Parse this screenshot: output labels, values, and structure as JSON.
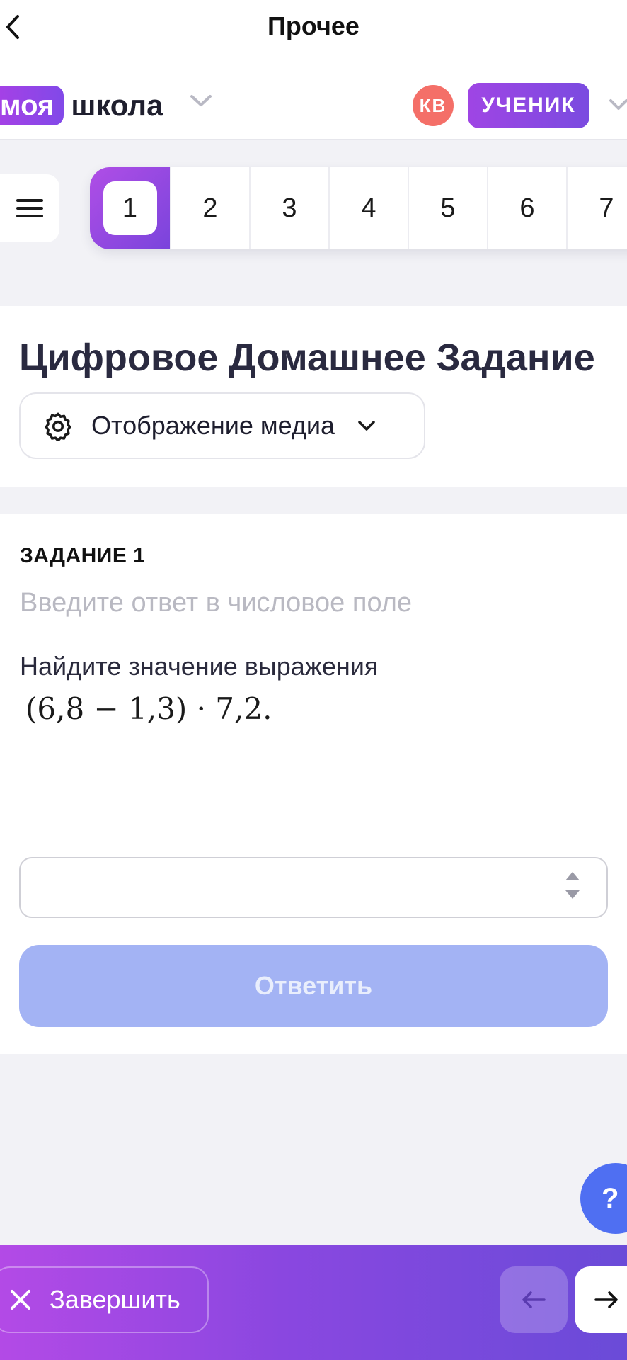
{
  "topbar": {
    "title": "Прочее"
  },
  "header": {
    "logo_badge": "моя",
    "logo_text": "школа",
    "avatar_initials": "КВ",
    "role": "УЧЕНИК"
  },
  "task_tabs": [
    "1",
    "2",
    "3",
    "4",
    "5",
    "6",
    "7"
  ],
  "active_task": "1",
  "page": {
    "title": "Цифровое Домашнее Задание",
    "media_label": "Отображение медиа"
  },
  "task": {
    "number": "ЗАДАНИЕ 1",
    "hint": "Введите ответ в числовое поле",
    "text": "Найдите значение выражения",
    "expression": "(6,8 − 1,3) · 7,2.",
    "answer_value": "",
    "submit_label": "Ответить"
  },
  "help": {
    "label": "?"
  },
  "bottombar": {
    "finish_label": "Завершить"
  },
  "colors": {
    "accent_start": "#b04ee6",
    "accent_end": "#6a4bd8",
    "avatar": "#f46f68",
    "submit_disabled": "#a3b3f4",
    "help": "#4f6ff2"
  }
}
